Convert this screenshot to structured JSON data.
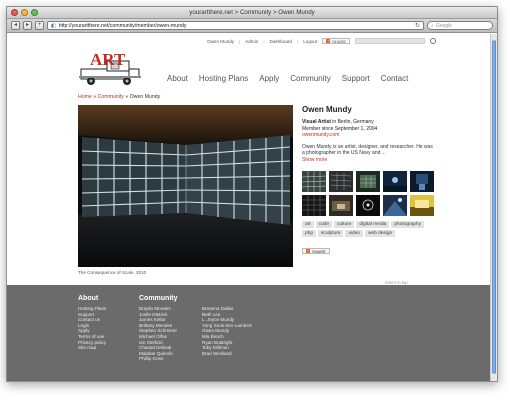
{
  "window": {
    "title": "yourartthere.net > Community > Owen Mundy"
  },
  "toolbar": {
    "url": "http://yourartthere.net/community/member/owen-mundy",
    "search_placeholder": "Google"
  },
  "utilbar": {
    "items": [
      "Owen Mundy",
      "Admin",
      "Dashboard",
      "Logout"
    ],
    "share_label": "SHARE"
  },
  "logo": {
    "text": "ART"
  },
  "nav": {
    "items": [
      "About",
      "Hosting Plans",
      "Apply",
      "Community",
      "Support",
      "Contact"
    ]
  },
  "breadcrumb": {
    "home": "Home",
    "community": "Community",
    "current": "Owen Mundy"
  },
  "photo": {
    "caption": "The Consequence of Scale, 2010"
  },
  "profile": {
    "name": "Owen Mundy",
    "role": "Visual Artist",
    "location": " in Berlin, Germany",
    "member_since": "Member since September 1, 2004",
    "website": "owenmundy.com",
    "bio": "Owen Mundy is an artist, designer, and researcher. He was a photographer in the US Navy and ...",
    "show_more": "Show more"
  },
  "tags": [
    "art",
    "code",
    "culture",
    "digital media",
    "photography",
    "php",
    "sculpture",
    "video",
    "web design"
  ],
  "share_label": "SHARE",
  "return_top": "return to top",
  "footer": {
    "about_title": "About",
    "about_links": [
      "Hosting Plans",
      "Support",
      "Contact us",
      "Login",
      "Apply",
      "Terms of use",
      "Privacy policy",
      "Site map"
    ],
    "community_title": "Community",
    "community_col1": [
      "Braylin Morales",
      "Joelle Dietrick",
      "James Kellar",
      "Brittany Morales",
      "Stephen Schreiner",
      "Michael Olfos",
      "Ian Sterlicki",
      "Chantal Delisak",
      "Malabar Quinnih",
      "Phillip Goss"
    ],
    "community_col2": [
      "Breanna Dallas",
      "Beth Lee",
      "L. Joyce Mundy",
      "Yong Sook Kim-Lambert",
      "Owen Mundy",
      "Mia Beach",
      "Ryan Boatright",
      "Toby Millman",
      "Brad Wickland"
    ]
  }
}
